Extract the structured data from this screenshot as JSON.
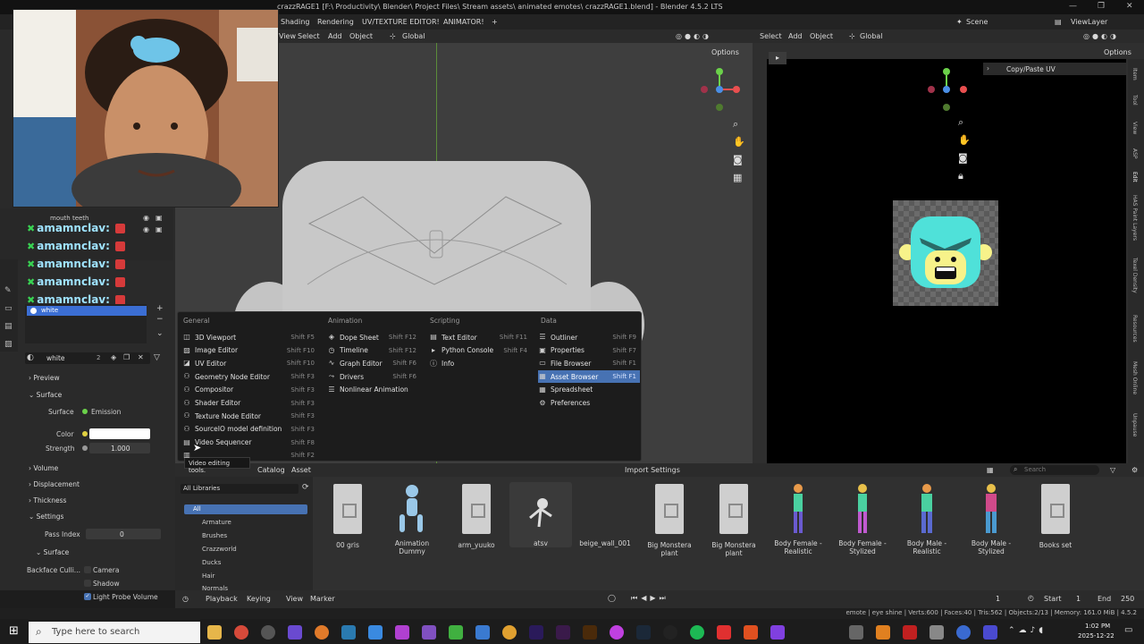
{
  "window": {
    "title": "crazzRAGE1 [F:\\ Productivity\\ Blender\\ Project Files\\ Stream assets\\ animated emotes\\ crazzRAGE1.blend] - Blender 4.5.2 LTS"
  },
  "workspaces": [
    "Shading",
    "Rendering",
    "UV/TEXTURE EDITOR!",
    "ANIMATOR!",
    "+"
  ],
  "scene": {
    "label": "Scene",
    "viewlayer": "ViewLayer"
  },
  "viewport_header": {
    "view": "View",
    "select": "Select",
    "add": "Add",
    "object": "Object",
    "orientation": "Global",
    "options": "Options"
  },
  "uv_header": {
    "select": "Select",
    "add": "Add",
    "object": "Object",
    "orientation": "Global",
    "options": "Options",
    "panel": "Copy/Paste UV"
  },
  "uv_tabs": [
    "Item",
    "Tool",
    "View",
    "ASP",
    "Edit",
    "HAS Paint Layers",
    "Texel Density",
    "Resources",
    "Mesh Online",
    "Unpause"
  ],
  "outliner": {
    "mouth_teeth": "mouth teeth",
    "chat_rows": [
      "amamnclav:",
      "amamnclav:",
      "amamnclav:",
      "amamnclav:",
      "amamnclav:"
    ]
  },
  "materials": {
    "slot": "white",
    "name_field": "white",
    "users": "2"
  },
  "properties": {
    "preview": "Preview",
    "surface_section": "Surface",
    "surface_label": "Surface",
    "surface_value": "Emission",
    "color_label": "Color",
    "strength_label": "Strength",
    "strength_value": "1.000",
    "volume": "Volume",
    "displacement": "Displacement",
    "thickness": "Thickness",
    "settings": "Settings",
    "pass_index_label": "Pass Index",
    "pass_index_value": "0",
    "surface_sub": "Surface",
    "backface_label": "Backface Culli...",
    "camera": "Camera",
    "shadow": "Shadow",
    "light_probe": "Light Probe Volume"
  },
  "editor_menu": {
    "general_title": "General",
    "animation_title": "Animation",
    "scripting_title": "Scripting",
    "data_title": "Data",
    "general": [
      {
        "label": "3D Viewport",
        "shortcut": "Shift F5",
        "icon": "cube-icon"
      },
      {
        "label": "Image Editor",
        "shortcut": "Shift F10",
        "icon": "image-icon"
      },
      {
        "label": "UV Editor",
        "shortcut": "Shift F10",
        "icon": "uv-icon"
      },
      {
        "label": "Geometry Node Editor",
        "shortcut": "Shift F3",
        "icon": "node-icon"
      },
      {
        "label": "Compositor",
        "shortcut": "Shift F3",
        "icon": "node-icon"
      },
      {
        "label": "Shader Editor",
        "shortcut": "Shift F3",
        "icon": "node-icon"
      },
      {
        "label": "Texture Node Editor",
        "shortcut": "Shift F3",
        "icon": "node-icon"
      },
      {
        "label": "SourceIO model definition",
        "shortcut": "Shift F3",
        "icon": "node-icon"
      },
      {
        "label": "Video Sequencer",
        "shortcut": "Shift F8",
        "icon": "film-icon"
      },
      {
        "label": "",
        "shortcut": "Shift F2",
        "icon": "clip-icon"
      }
    ],
    "animation": [
      {
        "label": "Dope Sheet",
        "shortcut": "Shift F12",
        "icon": "dope-icon"
      },
      {
        "label": "Timeline",
        "shortcut": "Shift F12",
        "icon": "clock-icon"
      },
      {
        "label": "Graph Editor",
        "shortcut": "Shift F6",
        "icon": "graph-icon"
      },
      {
        "label": "Drivers",
        "shortcut": "Shift F6",
        "icon": "driver-icon"
      },
      {
        "label": "Nonlinear Animation",
        "shortcut": "",
        "icon": "nla-icon"
      }
    ],
    "scripting": [
      {
        "label": "Text Editor",
        "shortcut": "Shift F11",
        "icon": "text-icon"
      },
      {
        "label": "Python Console",
        "shortcut": "Shift F4",
        "icon": "console-icon"
      },
      {
        "label": "Info",
        "shortcut": "",
        "icon": "info-icon"
      }
    ],
    "data": [
      {
        "label": "Outliner",
        "shortcut": "Shift F9",
        "icon": "list-icon"
      },
      {
        "label": "Properties",
        "shortcut": "Shift F7",
        "icon": "props-icon"
      },
      {
        "label": "File Browser",
        "shortcut": "Shift F1",
        "icon": "folder-icon"
      },
      {
        "label": "Asset Browser",
        "shortcut": "Shift F1",
        "icon": "asset-icon"
      },
      {
        "label": "Spreadsheet",
        "shortcut": "",
        "icon": "sheet-icon"
      },
      {
        "label": "Preferences",
        "shortcut": "",
        "icon": "gear-icon"
      }
    ],
    "tooltip": "Video editing tools."
  },
  "asset_browser": {
    "menu_catalog": "Catalog",
    "menu_asset": "Asset",
    "import_settings": "Import Settings",
    "search_placeholder": "Search",
    "library": "All Libraries",
    "catalog_all": "All",
    "catalogs": [
      "Armature",
      "Brushes",
      "Crazzworld",
      "Ducks",
      "Hair",
      "Normals"
    ],
    "assets": [
      {
        "name": "00 gris"
      },
      {
        "name": "Animation Dummy"
      },
      {
        "name": "arm_yuuko"
      },
      {
        "name": "atsv"
      },
      {
        "name": "beige_wall_001"
      },
      {
        "name": "Big Monstera plant"
      },
      {
        "name": "Big Monstera plant"
      },
      {
        "name": "Body Female - Realistic"
      },
      {
        "name": "Body Female - Stylized"
      },
      {
        "name": "Body Male - Realistic"
      },
      {
        "name": "Body Male - Stylized"
      },
      {
        "name": "Books set"
      }
    ]
  },
  "timeline": {
    "playback": "Playback",
    "keying": "Keying",
    "view": "View",
    "marker": "Marker",
    "current_frame": "1",
    "start_label": "Start",
    "start": "1",
    "end_label": "End",
    "end": "250"
  },
  "statusbar": "emote | eye shine | Verts:600 | Faces:40 | Tris:562 | Objects:2/13 | Memory: 161.0 MiB | 4.5.2",
  "taskbar": {
    "search_placeholder": "Type here to search",
    "time": "1:02 PM",
    "date": "2025-12-22"
  },
  "colors": {
    "selection_blue": "#4772b3",
    "chat_name": "#9fe3ff",
    "emote_cyan": "#4fe1d9",
    "emote_yellow": "#f7f28a"
  }
}
